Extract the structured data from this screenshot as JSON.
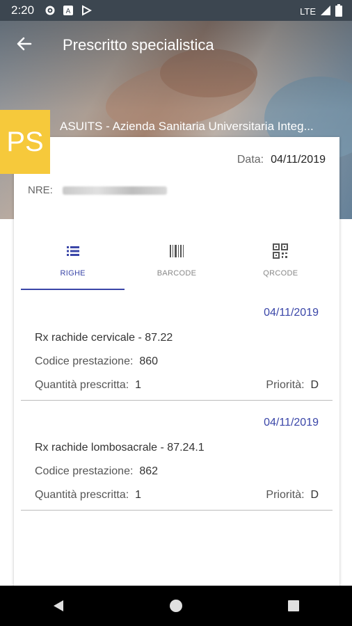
{
  "status": {
    "time": "2:20",
    "network": "LTE"
  },
  "header": {
    "title": "Prescritto specialistica",
    "org": "ASUITS - Azienda Sanitaria Universitaria Integ..."
  },
  "badge": {
    "text": "PS"
  },
  "card": {
    "date_label": "Data:",
    "date_value": "04/11/2019",
    "nre_label": "NRE:"
  },
  "tabs": [
    {
      "label": "RIGHE",
      "icon": "list-icon",
      "active": true
    },
    {
      "label": "BARCODE",
      "icon": "barcode-icon",
      "active": false
    },
    {
      "label": "QRCODE",
      "icon": "qrcode-icon",
      "active": false
    }
  ],
  "items": [
    {
      "date": "04/11/2019",
      "description": "Rx rachide cervicale - 87.22",
      "code_label": "Codice prestazione:",
      "code_value": "860",
      "qty_label": "Quantità prescritta:",
      "qty_value": "1",
      "priority_label": "Priorità:",
      "priority_value": "D"
    },
    {
      "date": "04/11/2019",
      "description": "Rx rachide lombosacrale - 87.24.1",
      "code_label": "Codice prestazione:",
      "code_value": "862",
      "qty_label": "Quantità prescritta:",
      "qty_value": "1",
      "priority_label": "Priorità:",
      "priority_value": "D"
    }
  ],
  "colors": {
    "accent": "#3a46a8",
    "badge": "#f6c93b",
    "statusbar": "#3c4650"
  }
}
